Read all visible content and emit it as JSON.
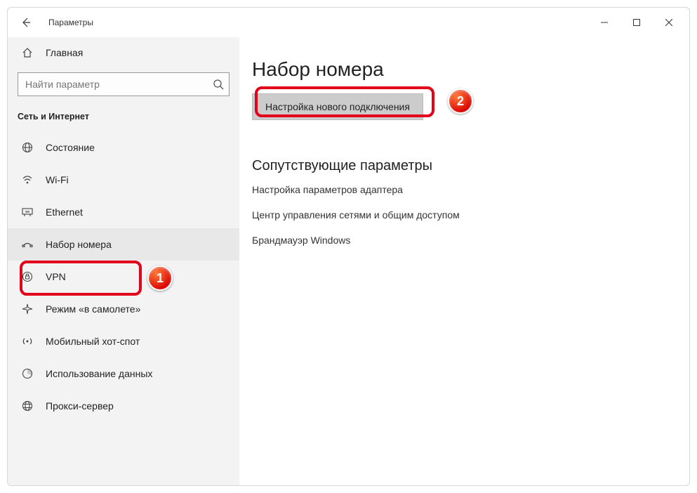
{
  "window": {
    "title": "Параметры"
  },
  "sidebar": {
    "home": "Главная",
    "search_placeholder": "Найти параметр",
    "section": "Сеть и Интернет",
    "items": [
      {
        "label": "Состояние",
        "icon": "globe"
      },
      {
        "label": "Wi-Fi",
        "icon": "wifi"
      },
      {
        "label": "Ethernet",
        "icon": "ethernet"
      },
      {
        "label": "Набор номера",
        "icon": "dialup",
        "selected": true
      },
      {
        "label": "VPN",
        "icon": "vpn"
      },
      {
        "label": "Режим «в самолете»",
        "icon": "airplane"
      },
      {
        "label": "Мобильный хот-спот",
        "icon": "hotspot"
      },
      {
        "label": "Использование данных",
        "icon": "datausage"
      },
      {
        "label": "Прокси-сервер",
        "icon": "proxy"
      }
    ]
  },
  "main": {
    "heading": "Набор номера",
    "primary_button": "Настройка нового подключения",
    "related_heading": "Сопутствующие параметры",
    "related_links": [
      "Настройка параметров адаптера",
      "Центр управления сетями и общим доступом",
      "Брандмауэр Windows"
    ]
  },
  "callouts": {
    "badge1": "1",
    "badge2": "2"
  }
}
